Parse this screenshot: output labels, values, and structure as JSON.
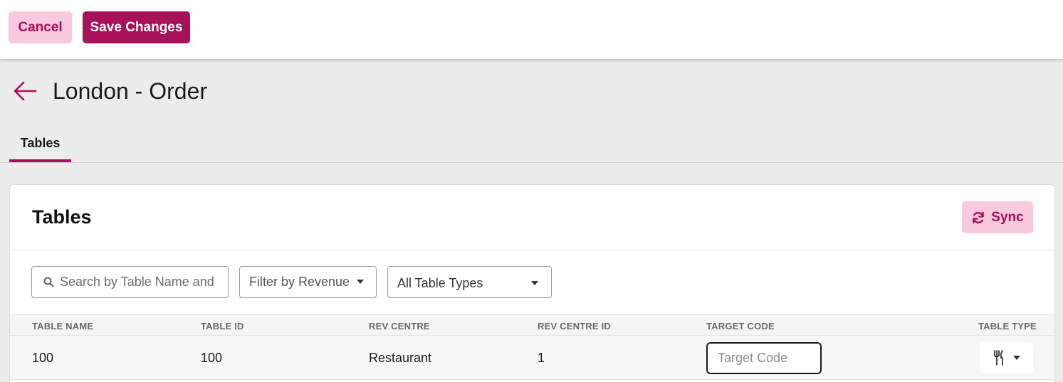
{
  "toolbar": {
    "cancel_label": "Cancel",
    "save_label": "Save Changes"
  },
  "header": {
    "title": "London - Order",
    "back_icon": "arrow-left-icon"
  },
  "tabs": [
    {
      "label": "Tables",
      "active": true
    }
  ],
  "card": {
    "title": "Tables",
    "sync_label": "Sync",
    "sync_icon": "refresh-icon"
  },
  "filters": {
    "search_placeholder": "Search by Table Name and",
    "revenue_placeholder": "Filter by Revenue",
    "table_type_value": "All Table Types"
  },
  "table": {
    "columns": [
      "TABLE NAME",
      "TABLE ID",
      "REV CENTRE",
      "REV CENTRE ID",
      "TARGET CODE",
      "TABLE TYPE"
    ],
    "rows": [
      {
        "table_name": "100",
        "table_id": "100",
        "rev_centre": "Restaurant",
        "rev_centre_id": "1",
        "target_code_placeholder": "Target Code",
        "target_code_value": "",
        "table_type_icon": "fork-knife-icon"
      }
    ]
  },
  "colors": {
    "brand": "#a8105a",
    "brand_light": "#f8c9df",
    "page_bg": "#ececec"
  }
}
